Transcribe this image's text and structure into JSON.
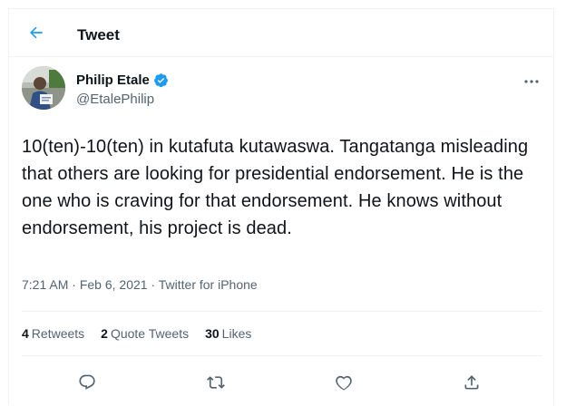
{
  "header": {
    "title": "Tweet"
  },
  "tweet": {
    "author_name": "Philip Etale",
    "author_handle": "@EtalePhilip",
    "text": "10(ten)-10(ten) in kutafuta kutawaswa. Tangatanga misleading that others are looking for presidential endorsement. He is the one who is craving for that endorsement. He knows without endorsement, his project is dead.",
    "time": "7:21 AM",
    "date": "Feb 6, 2021",
    "source": "Twitter for iPhone",
    "separator": "·"
  },
  "stats": {
    "retweets_count": "4",
    "retweets_label": "Retweets",
    "quotes_count": "2",
    "quotes_label": "Quote Tweets",
    "likes_count": "30",
    "likes_label": "Likes"
  },
  "icons": {
    "back": "arrow-left-icon",
    "verified": "verified-badge-icon",
    "more": "more-horizontal-icon",
    "reply": "reply-icon",
    "retweet": "retweet-icon",
    "like": "heart-icon",
    "share": "share-icon"
  },
  "colors": {
    "accent": "#1d9bf0",
    "text": "#0f1419",
    "secondary": "#536471",
    "border": "#eff3f4"
  }
}
